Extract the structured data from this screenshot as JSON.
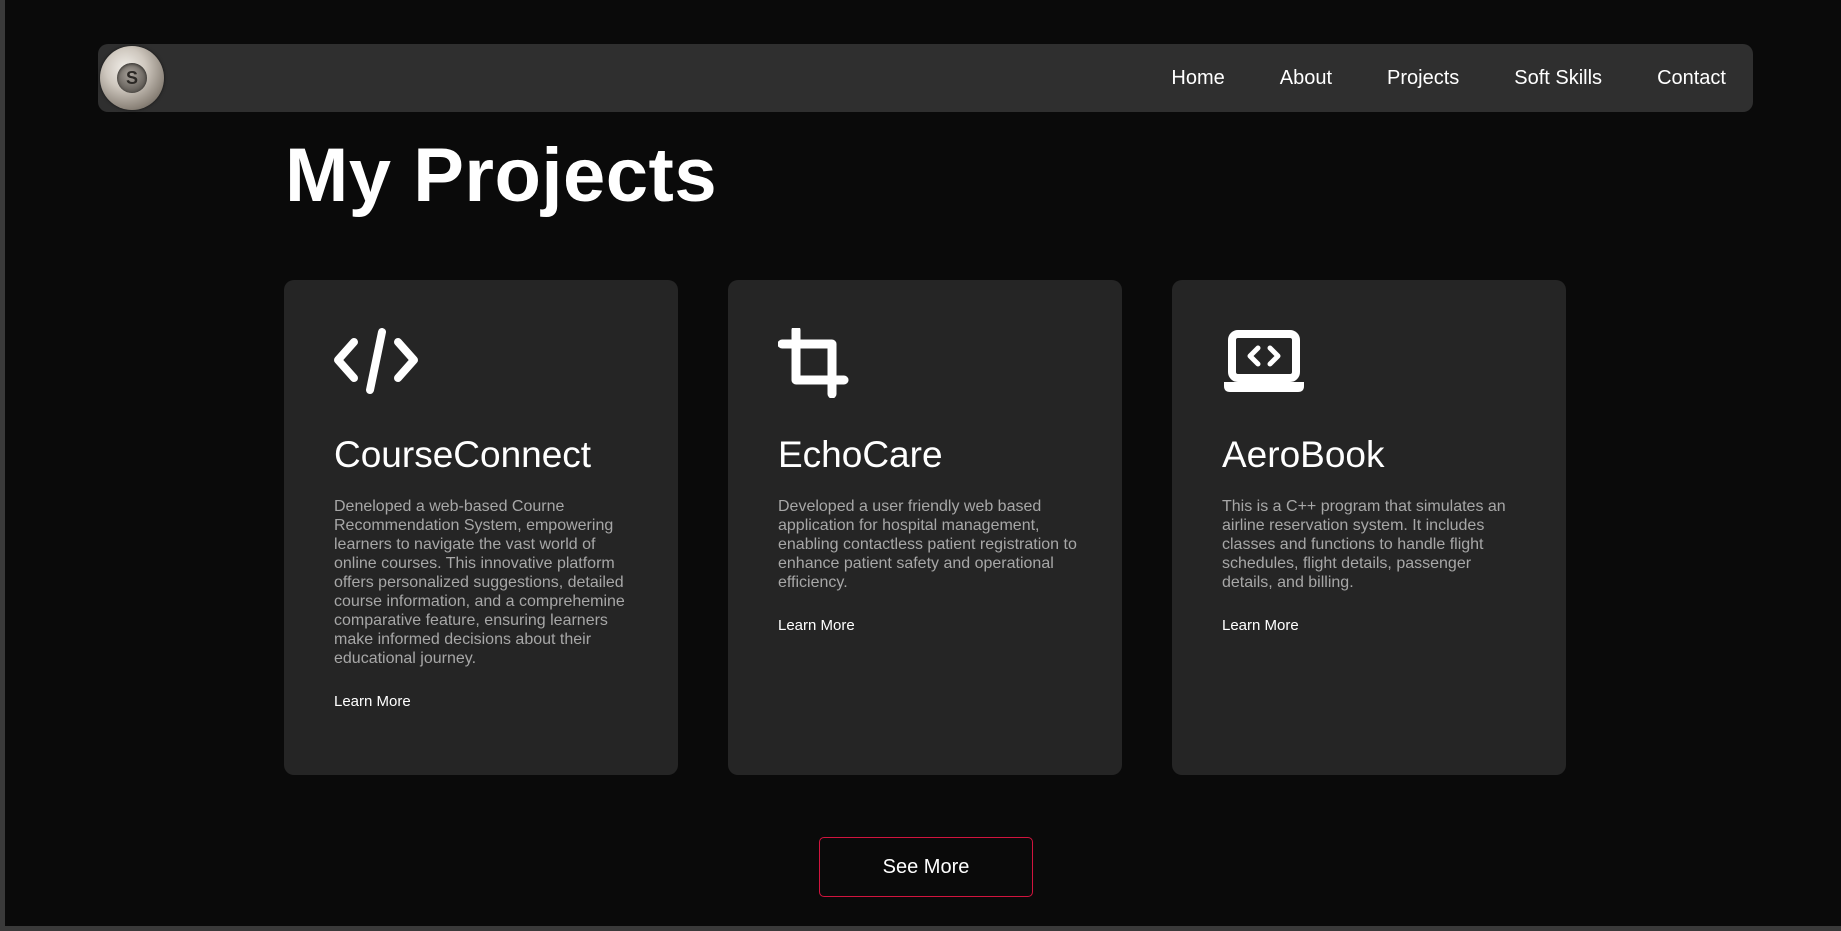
{
  "nav": {
    "links": [
      "Home",
      "About",
      "Projects",
      "Soft Skills",
      "Contact"
    ]
  },
  "main": {
    "title": "My Projects",
    "projects": [
      {
        "icon": "code-icon",
        "title": "CourseConnect",
        "description": "Deneloped a web-based Courne Recommendation System, empowering learners to navigate the vast world of online courses. This innovative platform offers personalized suggestions, detailed course information, and a comprehemine comparative feature, ensuring learners make informed decisions about their educational journey.",
        "link": "Learn More"
      },
      {
        "icon": "crop-icon",
        "title": "EchoCare",
        "description": "Developed a user friendly web based application for hospital management, enabling contactless patient registration to enhance patient safety and operational efficiency.",
        "link": "Learn More"
      },
      {
        "icon": "laptop-code-icon",
        "title": "AeroBook",
        "description": "This is a C++ program that simulates an airline reservation system. It includes classes and functions to handle flight schedules, flight details, passenger details, and billing.",
        "link": "Learn More"
      }
    ],
    "see_more": "See More"
  },
  "colors": {
    "background": "#0a0a0a",
    "navbar": "#2f2f2f",
    "card": "#252525",
    "accent_border": "#d1143e"
  }
}
